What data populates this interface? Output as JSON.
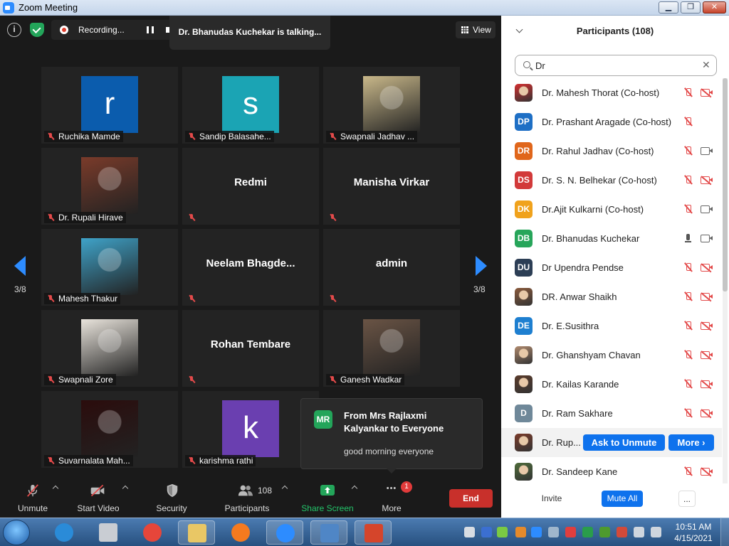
{
  "window": {
    "title": "Zoom Meeting",
    "minimize": "▁",
    "restore": "❐",
    "close": "✕"
  },
  "topbar": {
    "recording_label": "Recording...",
    "talking": "Dr. Bhanudas Kuchekar is talking...",
    "view_label": "View",
    "info_glyph": "i"
  },
  "gallery": {
    "page_left": "3/8",
    "page_right": "3/8",
    "tiles": [
      {
        "name": "Ruchika Mamde",
        "kind": "letter",
        "letter": "r",
        "color": "#0b5cad"
      },
      {
        "name": "Sandip Balasahe...",
        "kind": "letter",
        "letter": "s",
        "color": "#1ba4b4"
      },
      {
        "name": "Swapnali Jadhav ...",
        "kind": "photo",
        "color": "#c9b88a"
      },
      {
        "name": "Dr. Rupali Hirave",
        "kind": "photo",
        "color": "#7a3b2a"
      },
      {
        "name": "Redmi",
        "kind": "name",
        "center": "Redmi"
      },
      {
        "name": "Manisha Virkar",
        "kind": "name",
        "center": "Manisha Virkar"
      },
      {
        "name": "Mahesh Thakur",
        "kind": "photo",
        "color": "#3fa3c9"
      },
      {
        "name": "Neelam  Bhagde...",
        "kind": "name",
        "center": "Neelam  Bhagde..."
      },
      {
        "name": "admin",
        "kind": "name",
        "center": "admin"
      },
      {
        "name": "Swapnali Zore",
        "kind": "photo",
        "color": "#e9e4dc"
      },
      {
        "name": "Rohan Tembare",
        "kind": "name",
        "center": "Rohan Tembare"
      },
      {
        "name": "Ganesh Wadkar",
        "kind": "photo",
        "color": "#6a5445"
      },
      {
        "name": "Suvarnalata Mah...",
        "kind": "photo",
        "color": "#2b0c0c"
      },
      {
        "name": "karishma rathi",
        "kind": "letter",
        "letter": "k",
        "color": "#6a3fb0"
      }
    ]
  },
  "chat_popup": {
    "initials": "MR",
    "from": "From Mrs Rajlaxmi Kalyankar to Everyone",
    "message": "good morning everyone"
  },
  "toolbar": {
    "unmute": "Unmute",
    "start_video": "Start Video",
    "security": "Security",
    "participants": "Participants",
    "participants_count": "108",
    "share_screen": "Share Screen",
    "more": "More",
    "more_badge": "1",
    "end": "End",
    "more_glyph": "•••"
  },
  "panel": {
    "title": "Participants (108)",
    "search_value": "Dr",
    "clear_glyph": "✕",
    "ask_to_unmute": "Ask to Unmute",
    "more_button": "More ›",
    "participants": [
      {
        "name": "Dr. Mahesh Thorat (Co-host)",
        "initials": "",
        "avatar": "photo",
        "color": "#d32f2f",
        "mic": "muted",
        "cam": "off"
      },
      {
        "name": "Dr. Prashant Aragade (Co-host)",
        "initials": "DP",
        "avatar": "initials",
        "color": "#1e6fc5",
        "mic": "muted",
        "cam": "none"
      },
      {
        "name": "Dr. Rahul Jadhav (Co-host)",
        "initials": "DR",
        "avatar": "initials",
        "color": "#e0661b",
        "mic": "muted",
        "cam": "on"
      },
      {
        "name": "Dr. S. N. Belhekar (Co-host)",
        "initials": "DS",
        "avatar": "initials",
        "color": "#d23a3a",
        "mic": "muted",
        "cam": "off"
      },
      {
        "name": "Dr.Ajit Kulkarni (Co-host)",
        "initials": "DK",
        "avatar": "initials",
        "color": "#f0a21c",
        "mic": "muted",
        "cam": "on"
      },
      {
        "name": "Dr. Bhanudas Kuchekar",
        "initials": "DB",
        "avatar": "initials",
        "color": "#27a55a",
        "mic": "on",
        "cam": "on"
      },
      {
        "name": "Dr Upendra Pendse",
        "initials": "DU",
        "avatar": "initials",
        "color": "#2c3e55",
        "mic": "muted",
        "cam": "off"
      },
      {
        "name": "DR. Anwar Shaikh",
        "initials": "",
        "avatar": "photo",
        "color": "#8a5a3c",
        "mic": "muted",
        "cam": "off"
      },
      {
        "name": "Dr. E.Susithra",
        "initials": "DE",
        "avatar": "initials",
        "color": "#1e7fd0",
        "mic": "muted",
        "cam": "off"
      },
      {
        "name": "Dr. Ghanshyam Chavan",
        "initials": "",
        "avatar": "photo",
        "color": "#b08a6e",
        "mic": "muted",
        "cam": "off"
      },
      {
        "name": "Dr. Kailas Karande",
        "initials": "",
        "avatar": "photo",
        "color": "#5a3b2b",
        "mic": "muted",
        "cam": "off"
      },
      {
        "name": "Dr. Ram Sakhare",
        "initials": "D",
        "avatar": "initials",
        "color": "#6f8899",
        "mic": "muted",
        "cam": "off"
      },
      {
        "name": "Dr. Rup...",
        "initials": "",
        "avatar": "photo",
        "color": "#7a3b2a",
        "mic": "hover",
        "cam": "hover"
      },
      {
        "name": "Dr. Sandeep Kane",
        "initials": "",
        "avatar": "photo",
        "color": "#4e6b3a",
        "mic": "muted",
        "cam": "off"
      }
    ],
    "invite": "Invite",
    "mute_all": "Mute All",
    "more_options": "..."
  },
  "taskbar": {
    "time": "10:51 AM",
    "date": "4/15/2021",
    "apps": [
      {
        "name": "internet-explorer",
        "color": "#2a8bd8"
      },
      {
        "name": "scanner",
        "color": "#c9cdd3"
      },
      {
        "name": "chrome",
        "color": "#e6463a"
      },
      {
        "name": "file-explorer",
        "color": "#e9c765"
      },
      {
        "name": "firefox",
        "color": "#f57a1f"
      },
      {
        "name": "zoom",
        "color": "#2d8cff"
      },
      {
        "name": "photos",
        "color": "#4f86c6"
      },
      {
        "name": "presentation",
        "color": "#d5452b"
      }
    ]
  }
}
